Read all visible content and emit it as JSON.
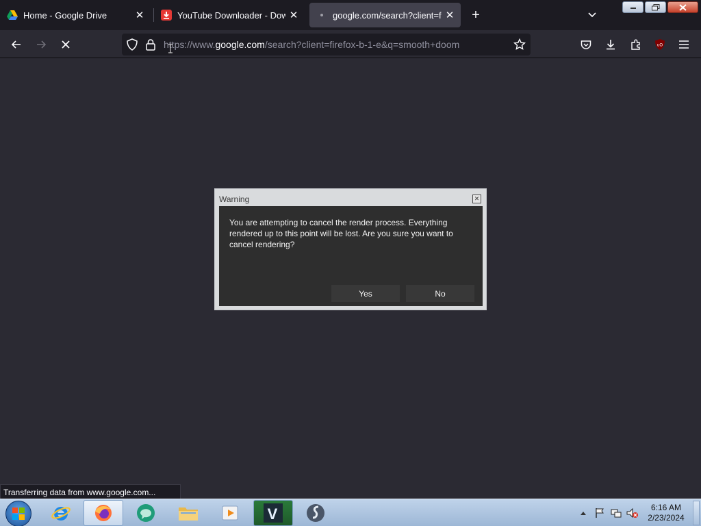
{
  "browser": {
    "tabs": [
      {
        "title": "Home - Google Drive",
        "favicon": "google-drive-icon",
        "active": false
      },
      {
        "title": "YouTube Downloader - Downlo",
        "favicon": "download-icon",
        "active": false
      },
      {
        "title": "google.com/search?client=firef",
        "favicon": "loading-dot-icon",
        "active": true
      }
    ],
    "url": {
      "prefix": "https://www.",
      "domain": "google.com",
      "path": "/search?client=firefox-b-1-e&q=smooth+doom"
    },
    "status_text": "Transferring data from www.google.com..."
  },
  "dialog": {
    "title": "Warning",
    "message": "You are attempting to cancel the render process. Everything rendered up to this point will be lost. Are you sure you want to cancel rendering?",
    "yes_label": "Yes",
    "no_label": "No"
  },
  "taskbar": {
    "apps": [
      "internet-explorer-icon",
      "firefox-icon",
      "chat-app-icon",
      "file-explorer-icon",
      "media-player-icon",
      "vegas-icon",
      "steam-icon"
    ],
    "time": "6:16 AM",
    "date": "2/23/2024"
  },
  "colors": {
    "page_bg": "#2b2a33",
    "tabbar_bg": "#1c1b22",
    "dialog_body": "#2e2e2e"
  }
}
